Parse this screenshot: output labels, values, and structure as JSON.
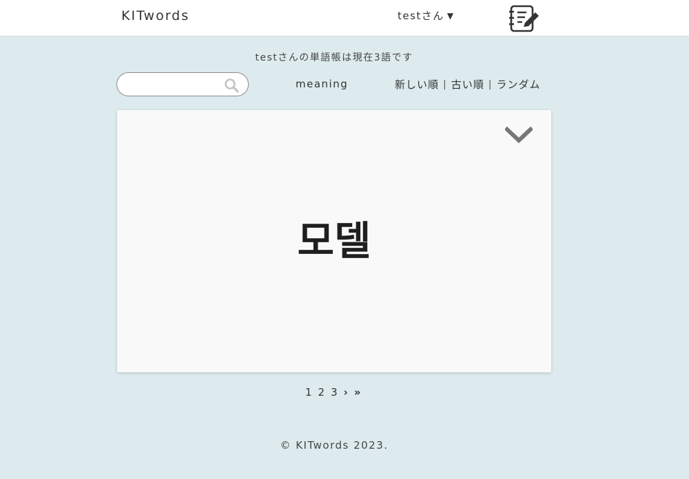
{
  "header": {
    "logo": "KITwords",
    "user_label": "testさん",
    "user_caret": "▼",
    "edit_icon": "notebook-edit-icon"
  },
  "toolbar": {
    "count_text": "testさんの単語帳は現在3語です",
    "search_placeholder": "",
    "search_icon": "search-icon",
    "mode_label": "meaning",
    "sort_newest": "新しい順",
    "sort_oldest": "古い順",
    "sort_random": "ランダム",
    "separator": "|"
  },
  "card": {
    "word": "모델",
    "toggle_icon": "chevron-down-icon"
  },
  "pagination": {
    "pages": [
      "1",
      "2",
      "3"
    ],
    "next": "›",
    "last": "»"
  },
  "footer": {
    "copyright": "© KITwords 2023."
  },
  "colors": {
    "background": "#ddebee",
    "header": "#ffffff",
    "card": "#f9f9f9",
    "icon_gray": "#777777"
  }
}
